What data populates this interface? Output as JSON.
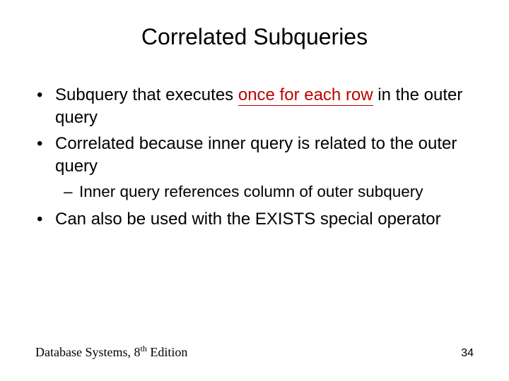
{
  "title": "Correlated Subqueries",
  "bullets": {
    "b1_pre": "Subquery that executes ",
    "b1_em": "once for each row",
    "b1_post": " in the outer query",
    "b2": "Correlated because inner query is related to the outer query",
    "b2a": "Inner query references column of outer subquery",
    "b3": "Can also be used with the EXISTS special operator"
  },
  "footer": {
    "book": "Database Systems, 8",
    "ord": "th",
    "edition": " Edition",
    "page": "34"
  }
}
